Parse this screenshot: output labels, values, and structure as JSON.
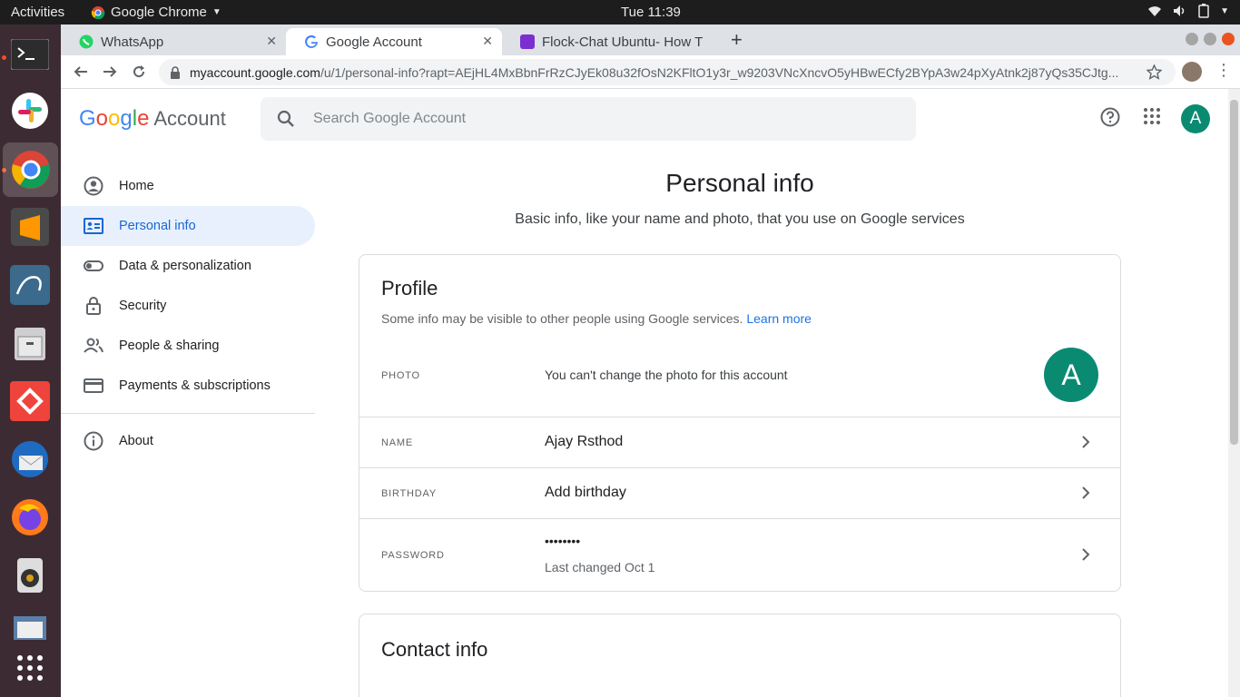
{
  "topbar": {
    "activities": "Activities",
    "app_name": "Google Chrome",
    "clock": "Tue 11:39"
  },
  "tabs": [
    {
      "label": "WhatsApp",
      "icon": "whatsapp-icon"
    },
    {
      "label": "Google Account",
      "icon": "google-icon"
    },
    {
      "label": "Flock-Chat Ubuntu- How T",
      "icon": "flock-icon"
    }
  ],
  "toolbar": {
    "url_host": "myaccount.google.com",
    "url_path": "/u/1/personal-info?rapt=AEjHL4MxBbnFrRzCJyEk08u32fOsN2KFltO1y3r_w9203VNcXncvO5yHBwECfy2BYpA3w24pXyAtnk2j87yQs35CJtg..."
  },
  "header": {
    "logo_google": "Google",
    "logo_account": "Account",
    "search_placeholder": "Search Google Account",
    "avatar_letter": "A"
  },
  "sidebar": {
    "items": [
      {
        "label": "Home",
        "icon": "home-icon"
      },
      {
        "label": "Personal info",
        "icon": "personal-info-icon"
      },
      {
        "label": "Data & personalization",
        "icon": "toggle-icon"
      },
      {
        "label": "Security",
        "icon": "lock-icon"
      },
      {
        "label": "People & sharing",
        "icon": "people-icon"
      },
      {
        "label": "Payments & subscriptions",
        "icon": "card-icon"
      },
      {
        "label": "About",
        "icon": "info-icon"
      }
    ]
  },
  "main": {
    "title": "Personal info",
    "subtitle": "Basic info, like your name and photo, that you use on Google services"
  },
  "profile": {
    "title": "Profile",
    "desc": "Some info may be visible to other people using Google services.",
    "learn_more": "Learn more",
    "photo_label": "PHOTO",
    "photo_value": "You can't change the photo for this account",
    "avatar_letter": "A",
    "name_label": "NAME",
    "name_value": "Ajay Rsthod",
    "birthday_label": "BIRTHDAY",
    "birthday_value": "Add birthday",
    "password_label": "PASSWORD",
    "password_value": "••••••••",
    "password_sub": "Last changed Oct 1"
  },
  "contact": {
    "title": "Contact info"
  },
  "colors": {
    "accent": "#1a73e8",
    "avatar": "#0b8a72",
    "ubuntu_orange": "#e95420"
  }
}
